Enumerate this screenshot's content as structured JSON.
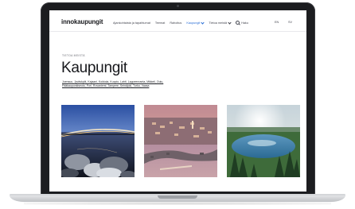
{
  "site": {
    "logo": "innokaupungit",
    "nav": [
      {
        "label": "Ajankohtaista ja tapahtumat",
        "active": false,
        "dropdown": false
      },
      {
        "label": "Teemat",
        "active": false,
        "dropdown": false
      },
      {
        "label": "Rahoitus",
        "active": false,
        "dropdown": false
      },
      {
        "label": "Kaupungit",
        "active": true,
        "dropdown": true
      },
      {
        "label": "Tietoa meistä",
        "active": false,
        "dropdown": true
      }
    ],
    "search_label": "Haku",
    "languages": [
      "EN",
      "SV"
    ],
    "accent_color": "#2a6fd6"
  },
  "page": {
    "eyebrow": "TIETOA MEISTÄ",
    "title": "Kaupungit",
    "cities_line1": "Joensuu, Jyväskylä, Kajaani, Kokkola, Kuopio, Lahti, Lappeenranta, Mikkeli, Oulu,",
    "cities_line2": "Pääkaupunkiseutu, Pori, Rovaniemi, Tampere, Seinäjoki, Turku, Vaasa"
  },
  "images": [
    {
      "icon": "bridge-night-photo"
    },
    {
      "icon": "city-aerial-photo"
    },
    {
      "icon": "lake-forest-photo"
    }
  ]
}
